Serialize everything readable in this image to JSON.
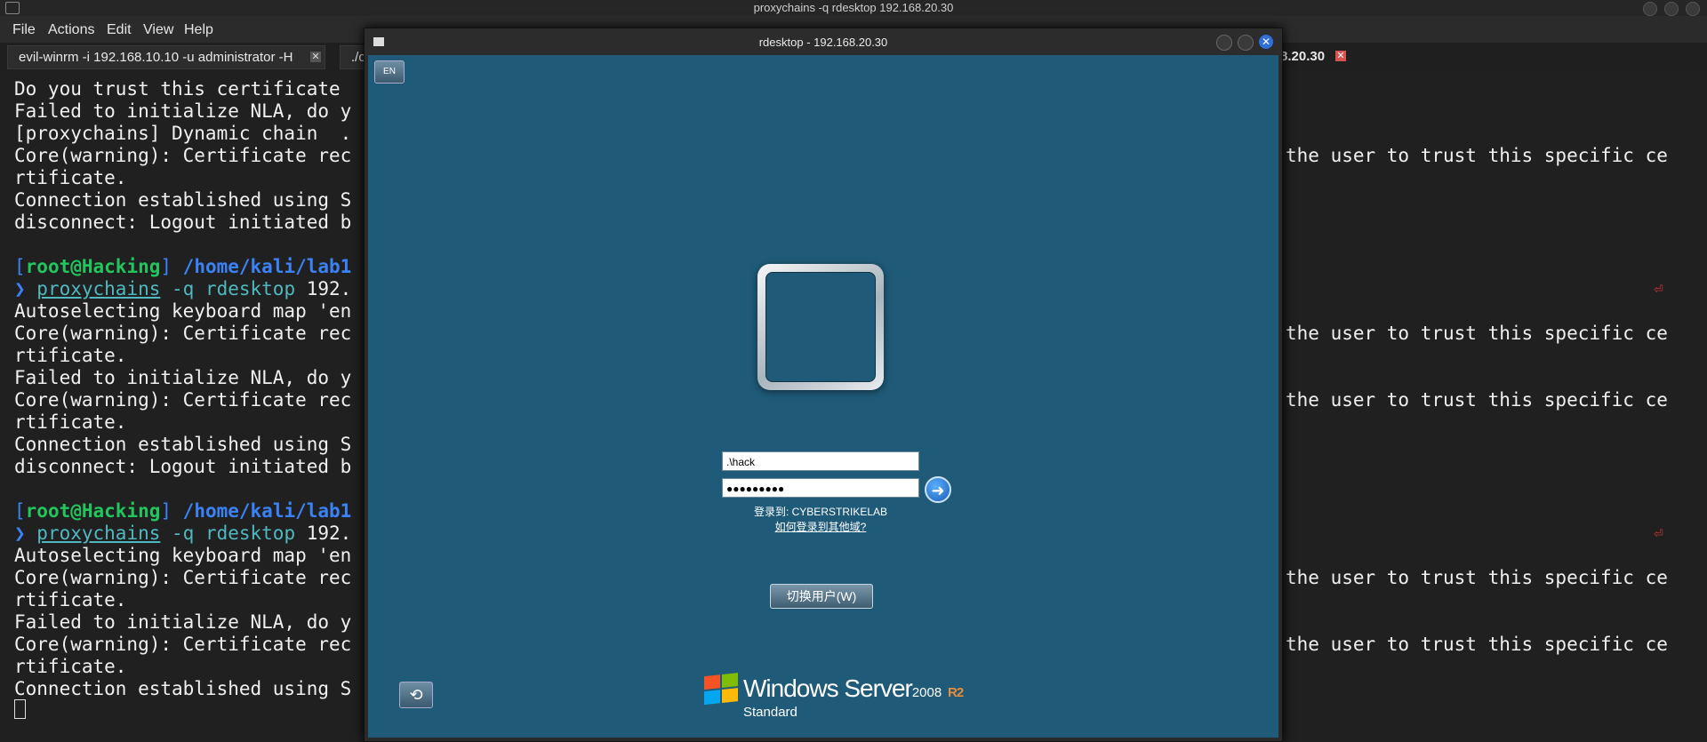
{
  "window": {
    "title": "proxychains -q rdesktop 192.168.20.30"
  },
  "menu": [
    "File",
    "Actions",
    "Edit",
    "View",
    "Help"
  ],
  "tabs": [
    {
      "label": "evil-winrm -i 192.168.10.10 -u administrator -H"
    },
    {
      "label": "./c"
    },
    {
      "label": "8.20.30"
    }
  ],
  "terminal": {
    "left_lines": [
      {
        "text": "Do you trust this certificate "
      },
      {
        "text": "Failed to initialize NLA, do y"
      },
      {
        "text": "[proxychains] Dynamic chain  ."
      },
      {
        "text": "Core(warning): Certificate rec"
      },
      {
        "text": "rtificate."
      },
      {
        "text": "Connection established using S"
      },
      {
        "text": "disconnect: Logout initiated b"
      },
      {
        "text": ""
      },
      {
        "prompt": true,
        "user": "root@Hacking",
        "path": "/home/kali/lab1"
      },
      {
        "command": true,
        "cmd": "proxychains",
        "args": "-q rdesktop",
        "rest": " 192."
      },
      {
        "text": "Autoselecting keyboard map 'en"
      },
      {
        "text": "Core(warning): Certificate rec"
      },
      {
        "text": "rtificate."
      },
      {
        "text": "Failed to initialize NLA, do y"
      },
      {
        "text": "Core(warning): Certificate rec"
      },
      {
        "text": "rtificate."
      },
      {
        "text": "Connection established using S"
      },
      {
        "text": "disconnect: Logout initiated b"
      },
      {
        "text": ""
      },
      {
        "prompt": true,
        "user": "root@Hacking",
        "path": "/home/kali/lab1"
      },
      {
        "command": true,
        "cmd": "proxychains",
        "args": "-q rdesktop",
        "rest": " 192."
      },
      {
        "text": "Autoselecting keyboard map 'en"
      },
      {
        "text": "Core(warning): Certificate rec"
      },
      {
        "text": "rtificate."
      },
      {
        "text": "Failed to initialize NLA, do y"
      },
      {
        "text": "Core(warning): Certificate rec"
      },
      {
        "text": "rtificate."
      },
      {
        "text": "Connection established using S"
      }
    ],
    "right_fragment": "the user to trust this specific ce",
    "right_line_rows": [
      3,
      11,
      14,
      22,
      25
    ]
  },
  "rdesktop": {
    "title": "rdesktop - 192.168.20.30",
    "language_indicator": "EN",
    "username_value": ".\\hack",
    "password_value": "●●●●●●●●●",
    "login_to": "登录到: CYBERSTRIKELAB",
    "other_domain_link": "如何登录到其他域?",
    "switch_user_button": "切换用户(W)",
    "brand": {
      "product": "Windows Server",
      "version": "2008",
      "release": "R2",
      "edition": "Standard"
    }
  },
  "colors": {
    "terminal_bg": "#202020",
    "login_bg": "#1f5a78",
    "prompt_blue": "#3b82f6",
    "prompt_green": "#22c55e",
    "command_cyan": "#4fb8c0"
  }
}
